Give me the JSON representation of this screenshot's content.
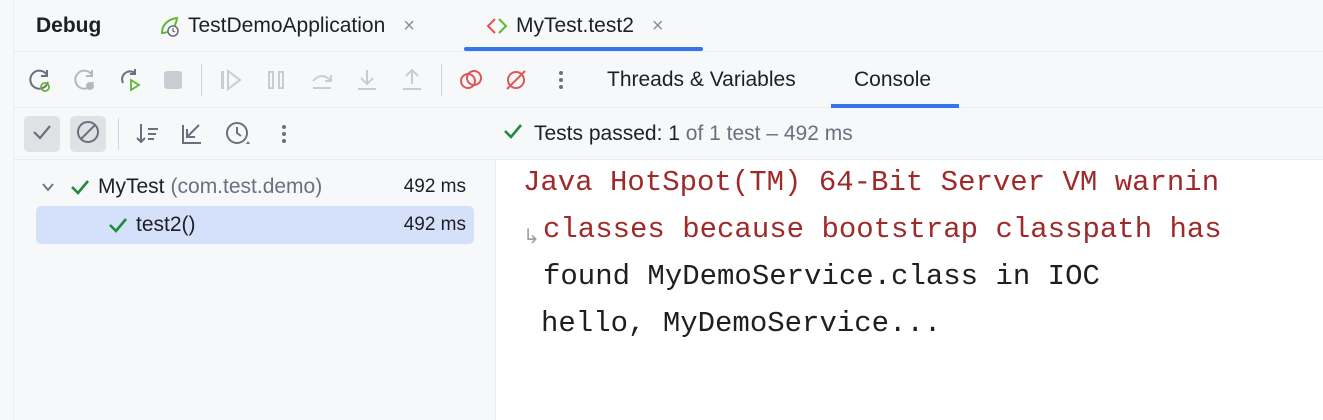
{
  "tabbar": {
    "title": "Debug",
    "tabs": [
      {
        "label": "TestDemoApplication",
        "icon": "spring-boot-debug-icon",
        "close": "×",
        "active": false
      },
      {
        "label": "MyTest.test2",
        "icon": "test-diff-icon",
        "close": "×",
        "active": true
      }
    ]
  },
  "toolbar": {
    "buttons": [
      "rerun-debug-icon",
      "rerun-icon",
      "rerun-failed-icon",
      "stop-icon",
      "resume-icon",
      "pause-icon",
      "step-over-icon",
      "step-into-icon",
      "step-out-icon",
      "view-breakpoints-icon",
      "mute-breakpoints-icon",
      "more-icon"
    ],
    "subtabs": [
      {
        "label": "Threads & Variables",
        "active": false
      },
      {
        "label": "Console",
        "active": true
      }
    ]
  },
  "testbar": {
    "status_prefix": "Tests passed:",
    "passed_count": "1",
    "status_suffix": "of 1 test – 492 ms"
  },
  "tree": {
    "items": [
      {
        "name": "MyTest",
        "package": "(com.test.demo)",
        "duration": "492 ms",
        "expanded": "⌄"
      },
      {
        "name": "test2()",
        "duration": "492 ms",
        "selected": true
      }
    ]
  },
  "console": {
    "lines": [
      {
        "text": "Java HotSpot(TM) 64-Bit Server VM warnin",
        "kind": "err"
      },
      {
        "text": "classes because bootstrap classpath has",
        "kind": "err"
      },
      {
        "text": "found MyDemoService.class in IOC",
        "kind": "out"
      },
      {
        "text": "hello, MyDemoService...",
        "kind": "out"
      }
    ],
    "wrap_marker": "↳"
  },
  "colors": {
    "accent": "#3574f0",
    "pass_green": "#208a3c",
    "error_red": "#9f2a2a",
    "selection": "#d5e1fb"
  }
}
